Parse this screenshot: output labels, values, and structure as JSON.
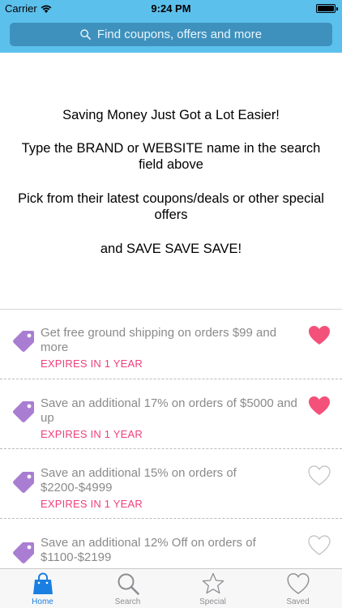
{
  "status_bar": {
    "carrier": "Carrier",
    "time": "9:24 PM"
  },
  "search": {
    "placeholder": "Find coupons, offers and more"
  },
  "intro": {
    "line1": "Saving Money Just Got a Lot Easier!",
    "line2": "Type the BRAND or WEBSITE name in the search field above",
    "line3": "Pick from their latest coupons/deals or other special offers",
    "line4": "and SAVE SAVE SAVE!"
  },
  "coupons": [
    {
      "text": "Get free ground shipping on orders $99 and more",
      "expires": "EXPIRES IN 1 YEAR",
      "saved": true
    },
    {
      "text": "Save an additional 17% on orders of $5000 and up",
      "expires": "EXPIRES IN 1 YEAR",
      "saved": true
    },
    {
      "text": "Save an additional 15% on orders of $2200-$4999",
      "expires": "EXPIRES IN 1 YEAR",
      "saved": false
    },
    {
      "text": "Save an additional 12% Off on orders of $1100-$2199",
      "expires": "",
      "saved": false
    }
  ],
  "tabs": [
    {
      "label": "Home",
      "icon": "shopping-bag-icon",
      "active": true
    },
    {
      "label": "Search",
      "icon": "search-icon",
      "active": false
    },
    {
      "label": "Special",
      "icon": "star-icon",
      "active": false
    },
    {
      "label": "Saved",
      "icon": "heart-icon",
      "active": false
    }
  ],
  "colors": {
    "header": "#5cc0ec",
    "search_field": "#3f91bd",
    "tag": "#a97ed2",
    "heart_active": "#f4517a",
    "expires": "#f0407a",
    "tab_active": "#1a7fe0"
  }
}
